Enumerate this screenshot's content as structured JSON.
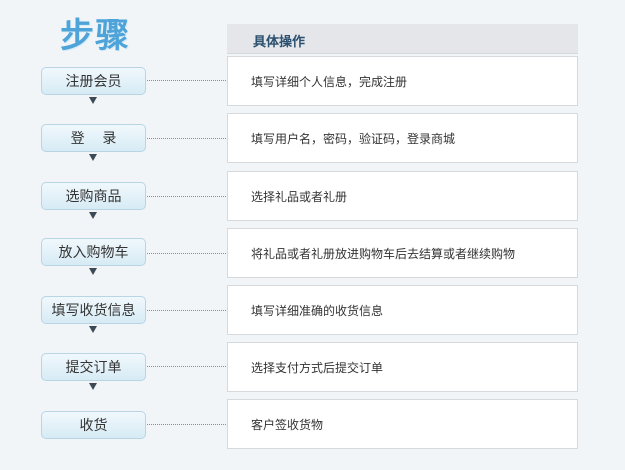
{
  "page": {
    "title": "步骤"
  },
  "table": {
    "column_header": "具体操作"
  },
  "steps": [
    {
      "label": "注册会员",
      "detail": "填写详细个人信息，完成注册"
    },
    {
      "label": "登    录",
      "detail": "填写用户名，密码，验证码，登录商城"
    },
    {
      "label": "选购商品",
      "detail": "选择礼品或者礼册"
    },
    {
      "label": "放入购物车",
      "detail": "将礼品或者礼册放进购物车后去结算或者继续购物"
    },
    {
      "label": "填写收货信息",
      "detail": "填写详细准确的收货信息"
    },
    {
      "label": "提交订单",
      "detail": "选择支付方式后提交订单"
    },
    {
      "label": "收货",
      "detail": "客户签收货物"
    }
  ],
  "colors": {
    "title": "#4ea3d8",
    "button_border": "#b9d4e3",
    "header_bg": "#e4e6e9"
  },
  "icons": {
    "step_connector": "down-arrow-icon"
  }
}
